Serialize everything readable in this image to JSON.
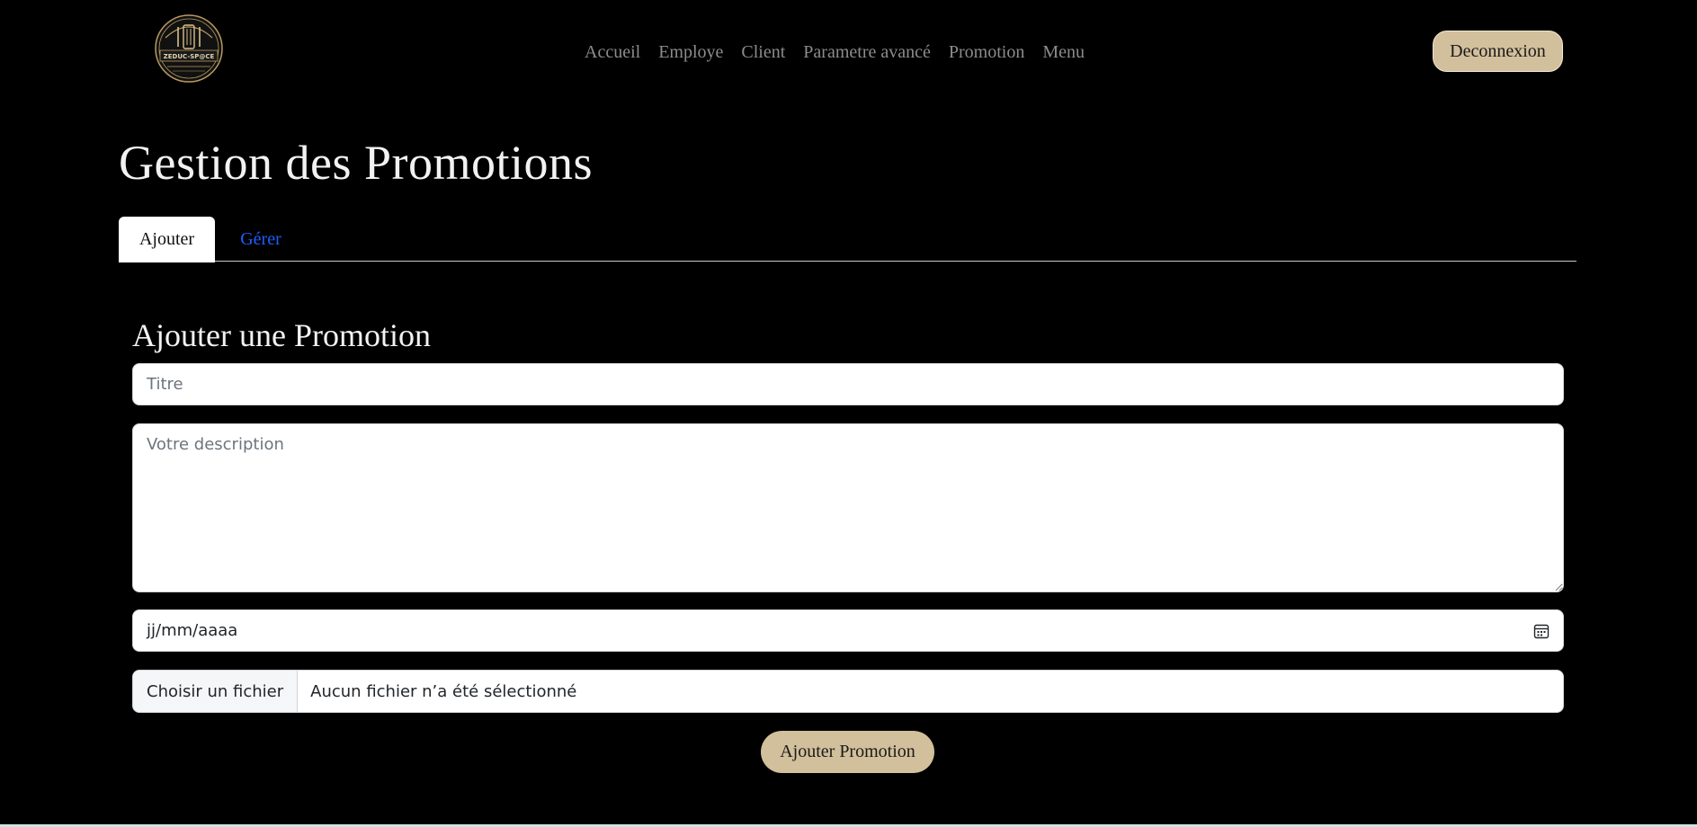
{
  "header": {
    "logo": {
      "icon": "restaurant-cutlery-emblem-icon",
      "text": "ZEDUC-SP@CE",
      "gold": "#b89a5e"
    },
    "nav": [
      {
        "label": "Accueil"
      },
      {
        "label": "Employe"
      },
      {
        "label": "Client"
      },
      {
        "label": "Parametre avancé"
      },
      {
        "label": "Promotion"
      },
      {
        "label": "Menu"
      }
    ],
    "logout_label": "Deconnexion"
  },
  "page": {
    "title": "Gestion des Promotions"
  },
  "tabs": [
    {
      "label": "Ajouter",
      "active": true
    },
    {
      "label": "Gérer",
      "active": false
    }
  ],
  "form": {
    "heading": "Ajouter une Promotion",
    "title_placeholder": "Titre",
    "title_value": "",
    "description_placeholder": "Votre description",
    "description_value": "",
    "date_placeholder": "jj/mm/aaaa",
    "date_icon": "calendar-icon",
    "file_button_label": "Choisir un fichier",
    "file_status": "Aucun fichier n’a été sélectionné",
    "submit_label": "Ajouter Promotion"
  },
  "colors": {
    "background": "#000000",
    "accent_beige": "#d2bf9b",
    "tab_link_blue": "#1e5fff",
    "nav_text": "#8c8c8c"
  }
}
